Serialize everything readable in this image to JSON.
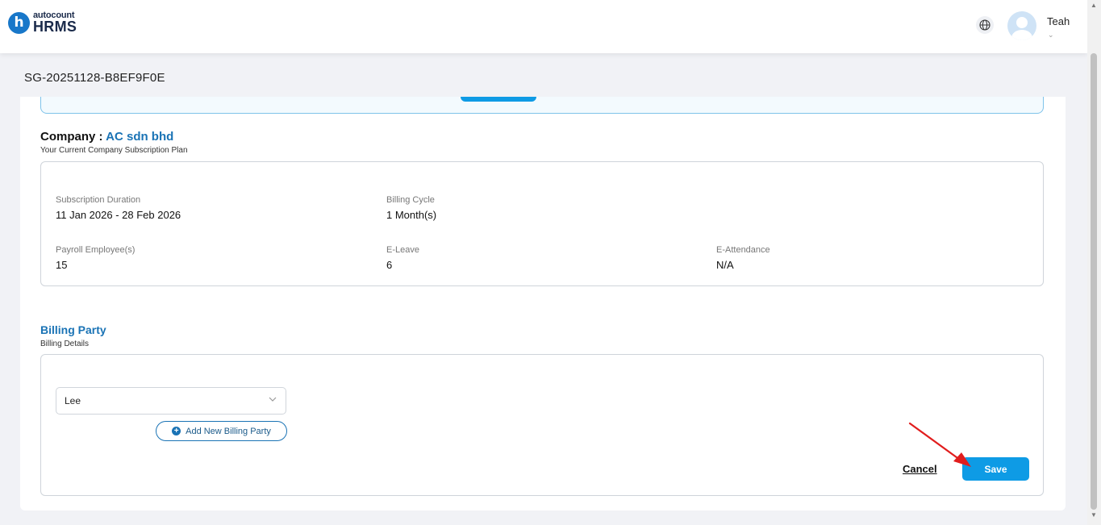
{
  "app": {
    "logo_small": "autocount",
    "logo_big": "HRMS",
    "logo_badge": "h"
  },
  "header": {
    "user_name": "Teah",
    "globe_icon": "globe-icon"
  },
  "page": {
    "id": "SG-20251128-B8EF9F0E"
  },
  "company": {
    "label": "Company :",
    "name": "AC sdn bhd",
    "subtitle": "Your Current Company Subscription Plan"
  },
  "plan": {
    "subscription_duration_label": "Subscription Duration",
    "subscription_duration_value": "11 Jan 2026 - 28 Feb 2026",
    "billing_cycle_label": "Billing Cycle",
    "billing_cycle_value": "1 Month(s)",
    "payroll_label": "Payroll Employee(s)",
    "payroll_value": "15",
    "eleave_label": "E-Leave",
    "eleave_value": "6",
    "eattendance_label": "E-Attendance",
    "eattendance_value": "N/A"
  },
  "billing": {
    "title": "Billing Party",
    "subtitle": "Billing Details",
    "selected_party": "Lee",
    "add_button_label": "Add New Billing Party",
    "cancel_label": "Cancel",
    "save_label": "Save"
  },
  "colors": {
    "accent": "#0e9be5",
    "brand": "#1a73b5",
    "annotation_arrow": "#e11d1d"
  }
}
